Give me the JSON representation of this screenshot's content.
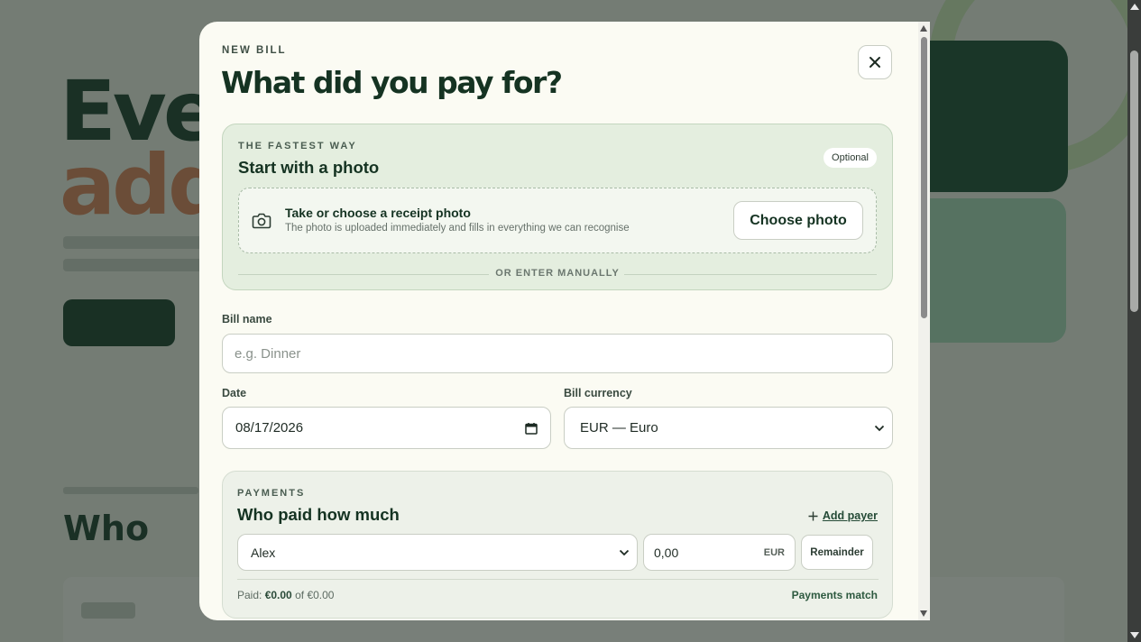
{
  "dialog": {
    "eyebrow": "NEW BILL",
    "title": "What did you pay for?",
    "close_icon": "close-icon"
  },
  "photo_section": {
    "eyebrow": "THE FASTEST WAY",
    "title": "Start with a photo",
    "badge": "Optional",
    "dropzone_icon": "camera-icon",
    "dropzone_title": "Take or choose a receipt photo",
    "dropzone_subtitle": "The photo is uploaded immediately and fills in everything we can recognise",
    "choose_button": "Choose photo",
    "divider": "OR ENTER MANUALLY"
  },
  "form": {
    "bill_name_label": "Bill name",
    "bill_name_value": "",
    "bill_name_placeholder": "e.g. Dinner",
    "date_label": "Date",
    "date_value": "08/17/2026",
    "currency_label": "Bill currency",
    "currency_value": "EUR — Euro"
  },
  "payments": {
    "eyebrow": "PAYMENTS",
    "title": "Who paid how much",
    "add_payer": "Add payer",
    "payer_value": "Alex",
    "amount_value": "0,00",
    "amount_currency": "EUR",
    "remainder_button": "Remainder",
    "paid_prefix": "Paid:",
    "paid_amount": "€0.00",
    "paid_of": "of",
    "paid_total": "€0.00",
    "status": "Payments match"
  },
  "colors": {
    "accent_dark": "#153322",
    "photo_card_bg": "#e4eedf",
    "modal_bg": "#fbfbf3"
  }
}
